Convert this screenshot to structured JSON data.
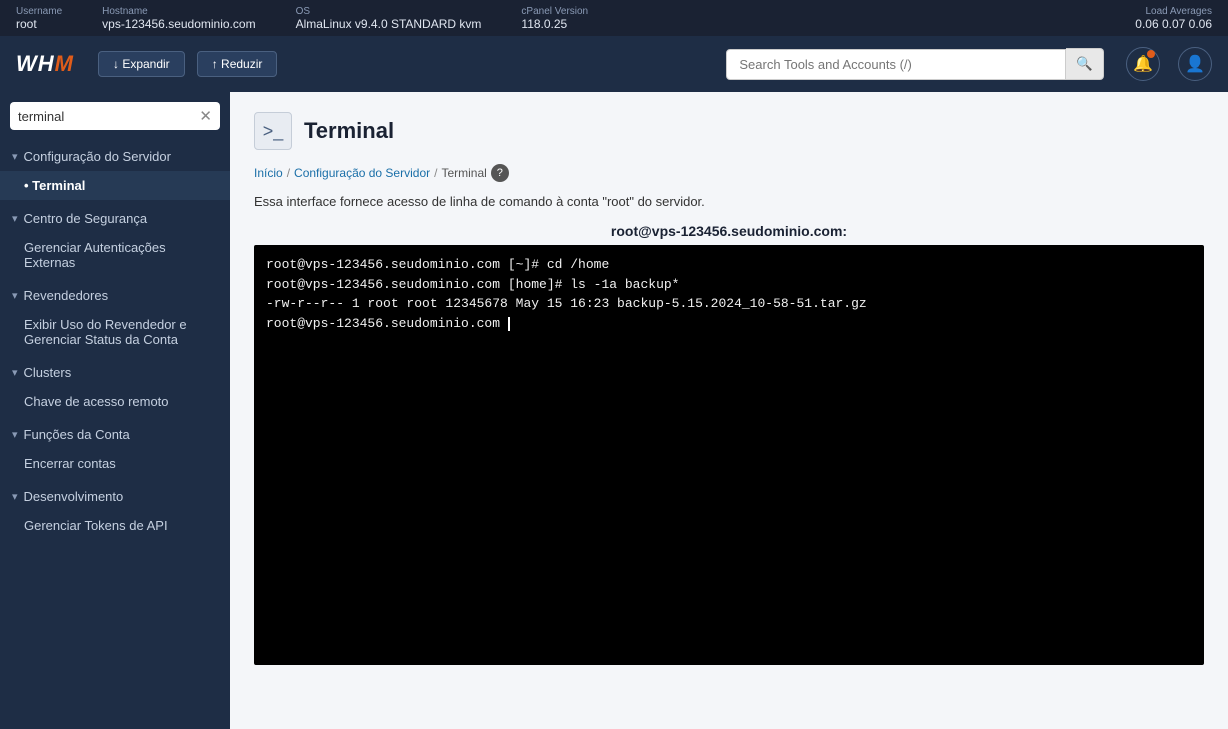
{
  "topbar": {
    "username_label": "Username",
    "username_value": "root",
    "hostname_label": "Hostname",
    "hostname_value": "vps-123456.seudominio.com",
    "os_label": "OS",
    "os_value": "AlmaLinux v9.4.0 STANDARD kvm",
    "cpanel_label": "cPanel Version",
    "cpanel_value": "118.0.25",
    "load_label": "Load Averages",
    "load_value": "0.06  0.07  0.06"
  },
  "header": {
    "logo": "WHM",
    "expand_label": "↓ Expandir",
    "reduce_label": "↑ Reduzir",
    "search_placeholder": "Search Tools and Accounts (/)"
  },
  "sidebar": {
    "search_value": "terminal",
    "groups": [
      {
        "label": "Configuração do Servidor",
        "expanded": true,
        "items": [
          {
            "label": "Terminal",
            "active": true
          }
        ]
      },
      {
        "label": "Centro de Segurança",
        "expanded": true,
        "items": [
          {
            "label": "Gerenciar Autenticações Externas",
            "active": false
          }
        ]
      },
      {
        "label": "Revendedores",
        "expanded": true,
        "items": [
          {
            "label": "Exibir Uso do Revendedor e Gerenciar Status da Conta",
            "active": false
          }
        ]
      },
      {
        "label": "Clusters",
        "expanded": true,
        "items": [
          {
            "label": "Chave de acesso remoto",
            "active": false
          }
        ]
      },
      {
        "label": "Funções da Conta",
        "expanded": true,
        "items": [
          {
            "label": "Encerrar contas",
            "active": false
          }
        ]
      },
      {
        "label": "Desenvolvimento",
        "expanded": true,
        "items": [
          {
            "label": "Gerenciar Tokens de API",
            "active": false
          }
        ]
      }
    ]
  },
  "page": {
    "title": "Terminal",
    "breadcrumb_home": "Início",
    "breadcrumb_sep1": "/",
    "breadcrumb_server": "Configuração do Servidor",
    "breadcrumb_sep2": "/",
    "breadcrumb_current": "Terminal",
    "description": "Essa interface fornece acesso de linha de comando à conta \"root\" do servidor.",
    "terminal_title": "root@vps-123456.seudominio.com:",
    "terminal_lines": [
      "root@vps-123456.seudominio.com [~]# cd /home",
      "root@vps-123456.seudominio.com [home]# ls -1a backup*",
      "-rw-r--r-- 1 root root 12345678 May 15 16:23 backup-5.15.2024_10-58-51.tar.gz",
      "root@vps-123456.seudominio.com "
    ]
  }
}
